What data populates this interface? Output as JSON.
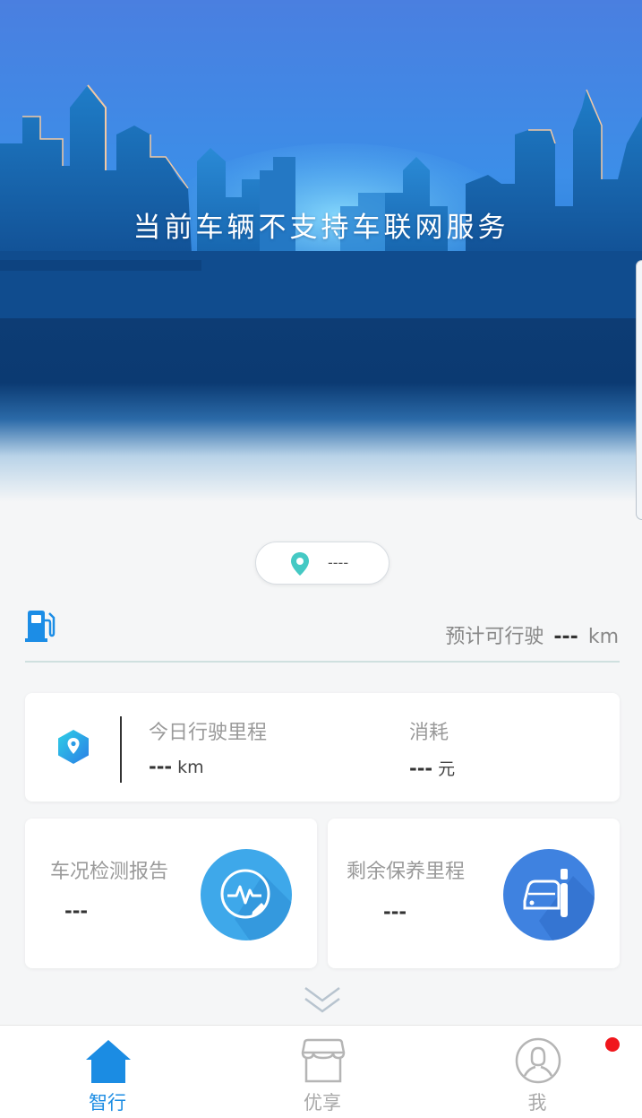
{
  "hero": {
    "message": "当前车辆不支持车联网服务"
  },
  "location": {
    "value": "----"
  },
  "range": {
    "label": "预计可行驶",
    "value": "---",
    "unit": "km"
  },
  "today": {
    "mileage_label": "今日行驶里程",
    "mileage_value": "---",
    "mileage_unit": "km",
    "cost_label": "消耗",
    "cost_value": "---",
    "cost_unit": "元"
  },
  "check_report": {
    "label": "车况检测报告",
    "value": "---"
  },
  "maintenance": {
    "label": "剩余保养里程",
    "value": "---"
  },
  "tabs": [
    {
      "label": "智行",
      "icon": "home-icon",
      "active": true
    },
    {
      "label": "优享",
      "icon": "store-icon",
      "active": false
    },
    {
      "label": "我",
      "icon": "user-icon",
      "active": false
    }
  ],
  "colors": {
    "accent": "#1b8ce3",
    "hero_sky": "#4a7fe0",
    "teal": "#45c9c4",
    "badge": "#f0161c",
    "check_icon_bg": "#3ea8ea",
    "maint_icon_bg": "#3f82e0"
  }
}
